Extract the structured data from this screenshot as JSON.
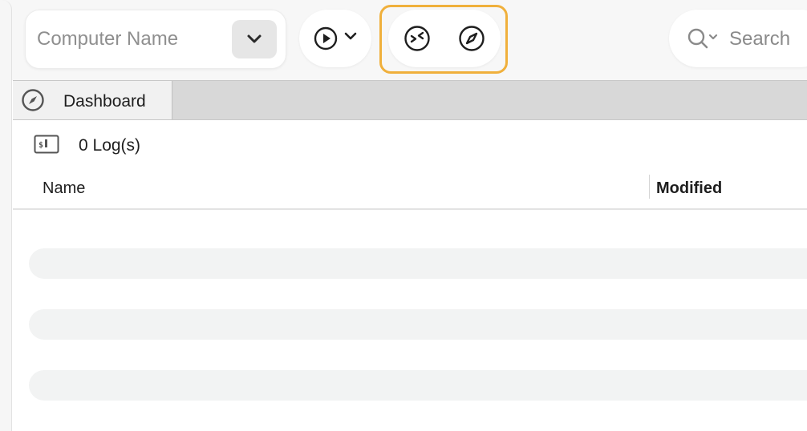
{
  "toolbar": {
    "computer_placeholder": "Computer Name",
    "search_label": "Search"
  },
  "icons": {
    "dropdown": "chevron-down-icon",
    "run": "play-icon",
    "run_menu": "chevron-down-icon",
    "remote": "remote-connect-icon",
    "browse": "compass-icon",
    "search": "search-icon",
    "tab": "compass-icon",
    "log": "terminal-icon"
  },
  "tabs": [
    {
      "label": "Dashboard"
    }
  ],
  "logs": {
    "count_label": "0 Log(s)"
  },
  "table": {
    "columns": [
      "Name",
      "Modified"
    ],
    "rows": []
  },
  "colors": {
    "highlight": "#f0b03c",
    "toolbar_bg": "#f7f7f7",
    "tabbar_bg": "#d8d8d8",
    "skeleton": "#f2f3f3"
  }
}
